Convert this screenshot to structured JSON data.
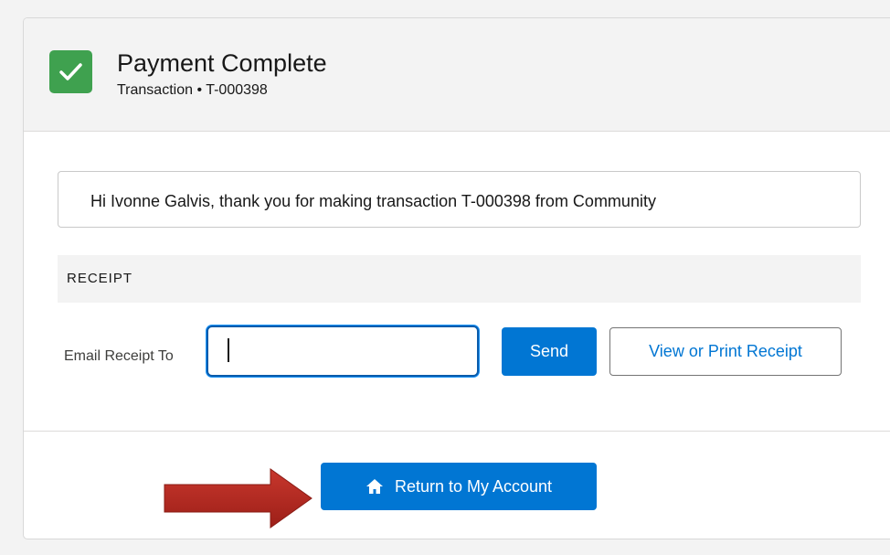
{
  "header": {
    "title": "Payment Complete",
    "subtitle": "Transaction • T-000398",
    "status_icon": "check-icon",
    "status_color": "#3fa14f"
  },
  "message": {
    "text": "Hi Ivonne Galvis, thank you for making transaction T-000398 from Community"
  },
  "receipt": {
    "section_title": "RECEIPT",
    "email_label": "Email Receipt To",
    "email_value": "",
    "send_label": "Send",
    "print_label": "View or Print Receipt"
  },
  "footer": {
    "return_label": "Return to My Account",
    "return_icon": "home-icon"
  },
  "colors": {
    "brand": "#0176d3",
    "annotation_arrow": "#b52a22"
  }
}
